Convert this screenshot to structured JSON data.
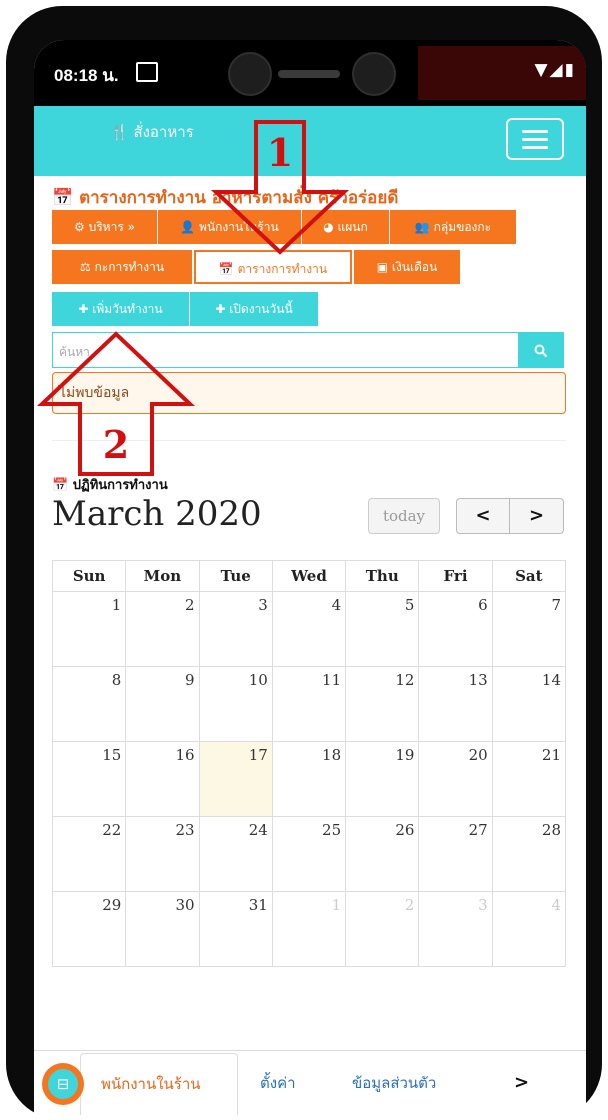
{
  "status": {
    "time": "08:18 น.",
    "icons_right": "▼◢▮"
  },
  "navbar": {
    "brand": "🍴 สั่งอาหาร",
    "menu_icon": "hamburger-icon"
  },
  "title": "📅 ตารางการทำงาน อาหารตามสั่ง ครัวอร่อยดี",
  "menu_row1": [
    "⚙ บริหาร »",
    "👤 พนักงานในร้าน",
    "◕ แผนก",
    "👥 กลุ่มของกะ"
  ],
  "menu_row2": [
    "⚖ กะการทำงาน",
    "📅 ตารางการทำงาน",
    "▣ เงินเดือน"
  ],
  "actions": [
    "✚ เพิ่มวันทำงาน",
    "✚ เปิดงานวันนี้"
  ],
  "search": {
    "placeholder": "ค้นหา",
    "button_icon": "search-icon"
  },
  "alert": "ไม่พบข้อมูล",
  "calendar": {
    "section_title": "📅 ปฏิทินการทำงาน",
    "month_title": "March 2020",
    "today_label": "today",
    "prev_label": "<",
    "next_label": ">",
    "weekdays": [
      "Sun",
      "Mon",
      "Tue",
      "Wed",
      "Thu",
      "Fri",
      "Sat"
    ],
    "weeks": [
      [
        "1",
        "2",
        "3",
        "4",
        "5",
        "6",
        "7"
      ],
      [
        "8",
        "9",
        "10",
        "11",
        "12",
        "13",
        "14"
      ],
      [
        "15",
        "16",
        "17",
        "18",
        "19",
        "20",
        "21"
      ],
      [
        "22",
        "23",
        "24",
        "25",
        "26",
        "27",
        "28"
      ],
      [
        "29",
        "30",
        "31",
        "1",
        "2",
        "3",
        "4"
      ]
    ],
    "today_date": "17"
  },
  "annotations": {
    "arrow1": "1",
    "arrow2": "2"
  },
  "bottom_nav": {
    "active_tab": "พนักงานในร้าน",
    "tabs": [
      "ตั้งค่า",
      "ข้อมูลส่วนตัว"
    ],
    "more_label": ">"
  },
  "colors": {
    "teal": "#3ed6da",
    "orange": "#f5761e",
    "annotation_red": "#d31010"
  }
}
